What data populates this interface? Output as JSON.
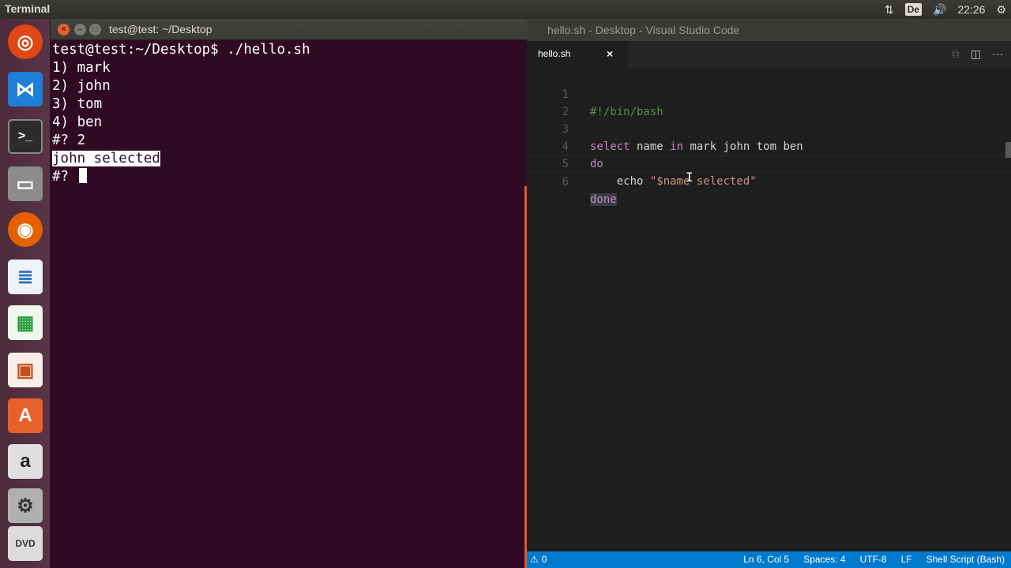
{
  "top_panel": {
    "app_title": "Terminal",
    "keyboard_layout": "De",
    "clock": "22:26"
  },
  "launcher": {
    "items": [
      {
        "name": "ubuntu-dash-icon",
        "color": "#dd4814"
      },
      {
        "name": "vscode-icon",
        "color": "#1e7fd6"
      },
      {
        "name": "terminal-icon",
        "color": "#2c2c2c"
      },
      {
        "name": "files-icon",
        "color": "#8c8c8c"
      },
      {
        "name": "firefox-icon",
        "color": "#e66000"
      },
      {
        "name": "writer-icon",
        "color": "#2a6fbf"
      },
      {
        "name": "calc-icon",
        "color": "#2e9e3e"
      },
      {
        "name": "impress-icon",
        "color": "#c4501b"
      },
      {
        "name": "software-center-icon",
        "color": "#e8602b"
      },
      {
        "name": "amazon-icon",
        "color": "#e0e0e0"
      },
      {
        "name": "system-settings-icon",
        "color": "#b0b0b0"
      },
      {
        "name": "dvd-icon",
        "color": "#dcdcdc"
      }
    ]
  },
  "terminal": {
    "title": "test@test: ~/Desktop",
    "lines": [
      "test@test:~/Desktop$ ./hello.sh",
      "1) mark",
      "2) john",
      "3) tom",
      "4) ben",
      "#? 2",
      "john selected",
      "#? "
    ]
  },
  "vscode": {
    "title": "hello.sh - Desktop - Visual Studio Code",
    "tab_label": "hello.sh",
    "tab_close": "×",
    "line_numbers": [
      "1",
      "2",
      "3",
      "4",
      "5",
      "6"
    ],
    "code": {
      "l1": "#!/bin/bash",
      "l3_kw1": "select",
      "l3_name": " name ",
      "l3_kw2": "in",
      "l3_rest": " mark john tom ben",
      "l4": "do",
      "l5_cmd": "    echo ",
      "l5_str": "\"$name selected\"",
      "l6": "done"
    },
    "status": {
      "problems": "0",
      "position": "Ln 6, Col 5",
      "spaces": "Spaces: 4",
      "encoding": "UTF-8",
      "eol": "LF",
      "language": "Shell Script (Bash)"
    }
  }
}
